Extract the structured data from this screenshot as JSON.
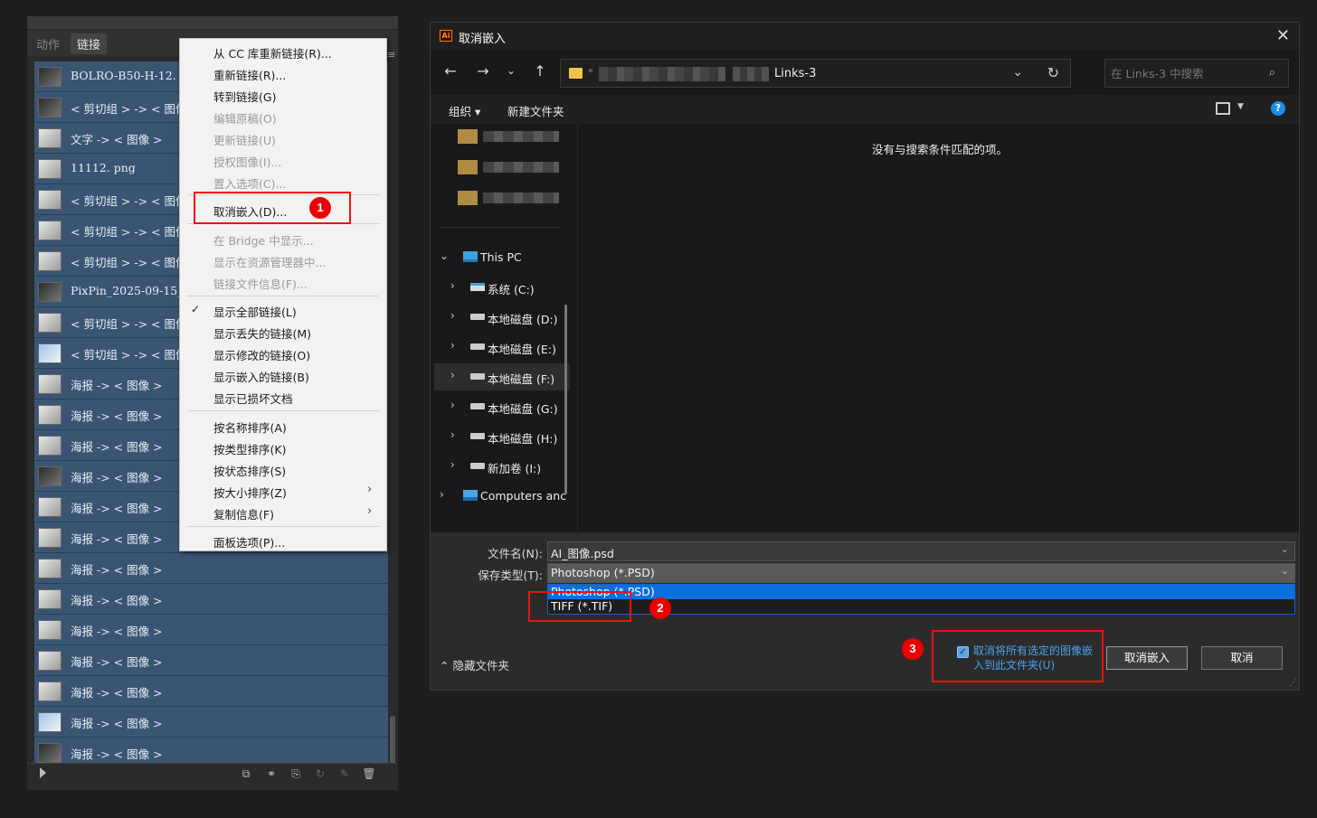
{
  "panel": {
    "tabs": [
      "动作",
      "链接"
    ],
    "rows": [
      {
        "label": "BOLRO-B50-H-12. png",
        "thumb": "dark"
      },
      {
        "label": "< 剪切组 > -> < 图像 >",
        "thumb": "dark"
      },
      {
        "label": "文字 -> < 图像 >",
        "thumb": "light"
      },
      {
        "label": "11112. png",
        "thumb": "light"
      },
      {
        "label": "< 剪切组 > -> < 图像 >",
        "thumb": "light"
      },
      {
        "label": "< 剪切组 > -> < 图像 >",
        "thumb": "light"
      },
      {
        "label": "< 剪切组 > -> < 图像 >",
        "thumb": "light"
      },
      {
        "label": "PixPin_2025-09-15_1",
        "thumb": "dark"
      },
      {
        "label": "< 剪切组 > -> < 图像 >",
        "thumb": "light"
      },
      {
        "label": "< 剪切组 > -> < 图像 >",
        "thumb": "blue"
      },
      {
        "label": "海报 -> < 图像 >",
        "thumb": "light"
      },
      {
        "label": "海报 -> < 图像 >",
        "thumb": "light"
      },
      {
        "label": "海报 -> < 图像 >",
        "thumb": "light"
      },
      {
        "label": "海报 -> < 图像 >",
        "thumb": "dark"
      },
      {
        "label": "海报 -> < 图像 >",
        "thumb": "light"
      },
      {
        "label": "海报 -> < 图像 >",
        "thumb": "light"
      },
      {
        "label": "海报 -> < 图像 >",
        "thumb": "light"
      },
      {
        "label": "海报 -> < 图像 >",
        "thumb": "light"
      },
      {
        "label": "海报 -> < 图像 >",
        "thumb": "light"
      },
      {
        "label": "海报 -> < 图像 >",
        "thumb": "light"
      },
      {
        "label": "海报 -> < 图像 >",
        "thumb": "light"
      },
      {
        "label": "海报 -> < 图像 >",
        "thumb": "blue"
      },
      {
        "label": "海报 -> < 图像 >",
        "thumb": "dark"
      }
    ]
  },
  "context_menu": {
    "items": [
      {
        "label": "从 CC 库重新链接(R)...",
        "disabled": false
      },
      {
        "label": "重新链接(R)...",
        "disabled": false
      },
      {
        "label": "转到链接(G)",
        "disabled": false
      },
      {
        "label": "编辑原稿(O)",
        "disabled": true
      },
      {
        "label": "更新链接(U)",
        "disabled": true
      },
      {
        "label": "授权图像(I)...",
        "disabled": true
      },
      {
        "label": "置入选项(C)...",
        "disabled": true
      },
      {
        "label": "取消嵌入(D)...",
        "disabled": false
      },
      {
        "label": "在 Bridge 中显示...",
        "disabled": true
      },
      {
        "label": "显示在资源管理器中...",
        "disabled": true
      },
      {
        "label": "链接文件信息(F)...",
        "disabled": true
      },
      {
        "label": "显示全部链接(L)",
        "disabled": false,
        "checked": true
      },
      {
        "label": "显示丢失的链接(M)",
        "disabled": false
      },
      {
        "label": "显示修改的链接(O)",
        "disabled": false
      },
      {
        "label": "显示嵌入的链接(B)",
        "disabled": false
      },
      {
        "label": "显示已损坏文档",
        "disabled": false
      },
      {
        "label": "按名称排序(A)",
        "disabled": false
      },
      {
        "label": "按类型排序(K)",
        "disabled": false
      },
      {
        "label": "按状态排序(S)",
        "disabled": false
      },
      {
        "label": "按大小排序(Z)",
        "disabled": false,
        "submenu": true
      },
      {
        "label": "复制信息(F)",
        "disabled": false,
        "submenu": true
      },
      {
        "label": "面板选项(P)...",
        "disabled": false
      }
    ]
  },
  "badges": [
    "1",
    "2",
    "3"
  ],
  "dialog": {
    "title": "取消嵌入",
    "app_icon": "Ai",
    "path": {
      "prefix": "«",
      "current": "Links-3"
    },
    "search_placeholder": "在 Links-3 中搜索",
    "toolbar": {
      "organize": "组织 ▾",
      "new_folder": "新建文件夹"
    },
    "tree": {
      "this_pc": "This PC",
      "drives": [
        "系统 (C:)",
        "本地磁盘 (D:)",
        "本地磁盘 (E:)",
        "本地磁盘 (F:)",
        "本地磁盘 (G:)",
        "本地磁盘 (H:)",
        "新加卷 (I:)"
      ],
      "network": "Computers anc"
    },
    "empty_message": "没有与搜索条件匹配的项。",
    "filename_label": "文件名(N):",
    "filename_value": "AI_图像.psd",
    "savetype_label": "保存类型(T):",
    "savetype_value": "Photoshop (*.PSD)",
    "savetype_options": [
      "Photoshop (*.PSD)",
      "TIFF (*.TIF)"
    ],
    "hide_folders": "隐藏文件夹",
    "checkbox_label": "取消将所有选定的图像嵌入到此文件夹(U)",
    "primary_button": "取消嵌入",
    "cancel_button": "取消"
  },
  "colors": {
    "accent": "#0a6fe0",
    "annotation": "#e11111",
    "row": "#3a5574"
  }
}
